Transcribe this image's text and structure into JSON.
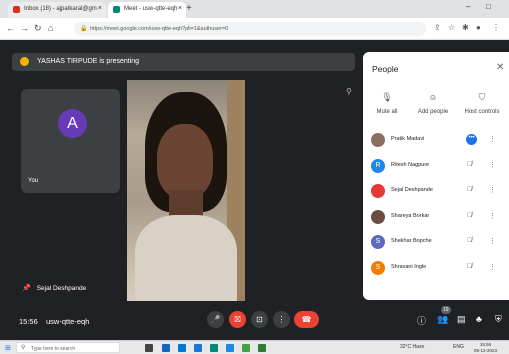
{
  "browser": {
    "tabs": [
      {
        "label": "Inbox (18) - ajpatkaral@gm",
        "favicon_color": "#d93025"
      },
      {
        "label": "Meet - usw-qtte-eqh",
        "favicon_color": "#00897b"
      }
    ],
    "url": "https://meet.google.com/usw-qtte-eqh?pli=1&authuser=0"
  },
  "meet": {
    "presenting_banner": "YASHAS TIRPUDE is presenting",
    "self_tile": {
      "initial": "A",
      "label": "You",
      "avatar_color": "#673ab7"
    },
    "main_speaker_label": "Sejal Deshpande",
    "time": "15:56",
    "meeting_code": "usw-qtte-eqh",
    "participant_count": "19",
    "controls": {
      "mic": "🎤",
      "camera_off": "⛝",
      "present": "⊡",
      "more": "⋮",
      "hangup": "☎"
    }
  },
  "people_panel": {
    "title": "People",
    "actions": [
      {
        "label": "Mute all",
        "icon": "mic-off-icon"
      },
      {
        "label": "Add people",
        "icon": "person-add-icon"
      },
      {
        "label": "Host controls",
        "icon": "shield-icon"
      }
    ],
    "participants": [
      {
        "name": "Pratik Madavi",
        "initial": "",
        "color": "#8d6e63",
        "speaking": true
      },
      {
        "name": "Ritesh Nagpure",
        "initial": "R",
        "color": "#1e88e5",
        "speaking": false
      },
      {
        "name": "Sejal Deshpande",
        "initial": "",
        "color": "#e53935",
        "speaking": false
      },
      {
        "name": "Shareya Borkar",
        "initial": "",
        "color": "#6d4c41",
        "speaking": false
      },
      {
        "name": "Shekhar Bopche",
        "initial": "S",
        "color": "#5c6bc0",
        "speaking": false
      },
      {
        "name": "Shravani Ingle",
        "initial": "S",
        "color": "#f57c00",
        "speaking": false
      }
    ]
  },
  "taskbar": {
    "search_placeholder": "Type here to search",
    "weather": "32°C Haze",
    "lang": "ENG",
    "clock_time": "15:56",
    "clock_date": "05-12-2023"
  }
}
